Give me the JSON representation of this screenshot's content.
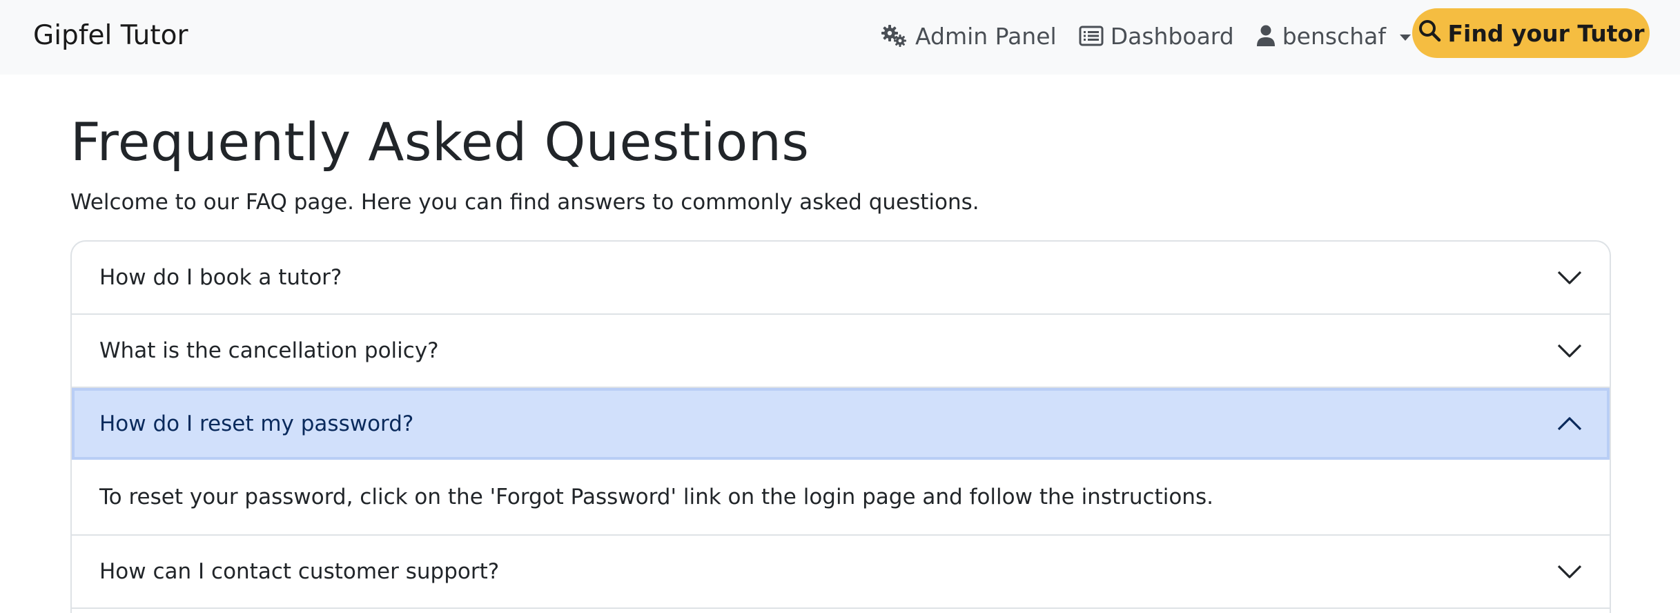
{
  "app": {
    "brand": "Gipfel Tutor"
  },
  "nav": {
    "admin_panel": "Admin Panel",
    "dashboard": "Dashboard",
    "user": "benschaf",
    "find_tutor": "Find your Tutor",
    "icons": {
      "admin": "gears-icon",
      "dashboard": "list-icon",
      "user": "user-icon",
      "find": "search-icon"
    },
    "accent_color": "#f5bd41"
  },
  "page": {
    "title": "Frequently Asked Questions",
    "intro": "Welcome to our FAQ page. Here you can find answers to commonly asked questions."
  },
  "faq": {
    "items": [
      {
        "question": "How do I book a tutor?",
        "expanded": false
      },
      {
        "question": "What is the cancellation policy?",
        "expanded": false
      },
      {
        "question": "How do I reset my password?",
        "expanded": true,
        "answer": "To reset your password, click on the 'Forgot Password' link on the login page and follow the instructions."
      },
      {
        "question": "How can I contact customer support?",
        "expanded": false
      }
    ],
    "active_color": "#d1e0fb"
  }
}
